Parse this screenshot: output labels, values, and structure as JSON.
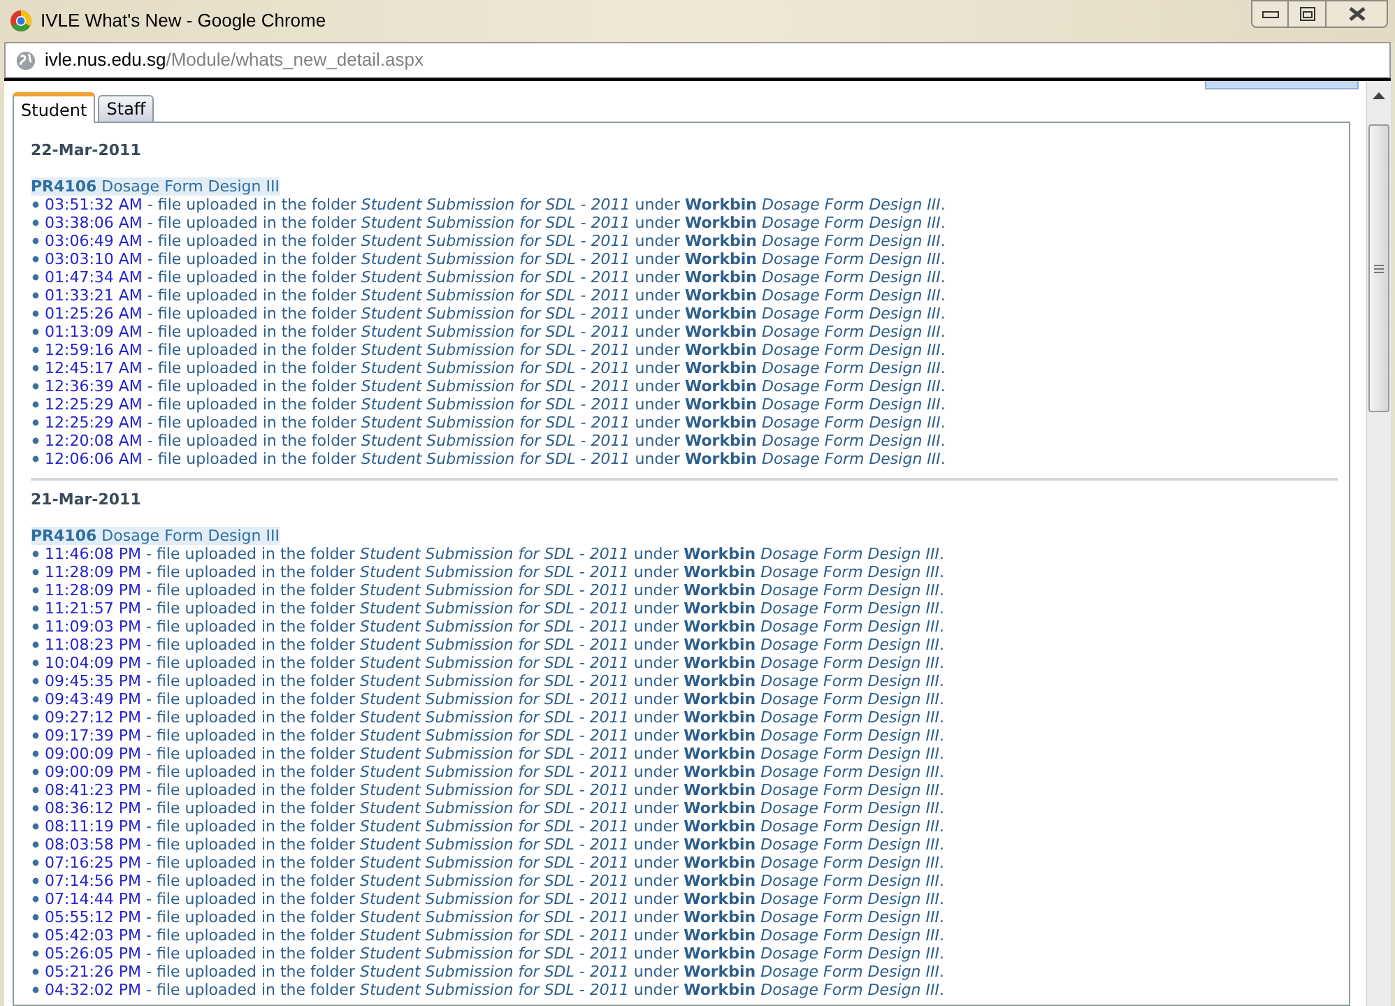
{
  "window": {
    "title": "IVLE What's New - Google Chrome"
  },
  "address_bar": {
    "host": "ivle.nus.edu.sg",
    "path": "/Module/whats_new_detail.aspx"
  },
  "tabs": [
    {
      "label": "Student",
      "selected": true
    },
    {
      "label": "Staff",
      "selected": false
    }
  ],
  "groups": [
    {
      "date": "22-Mar-2011",
      "module": {
        "code": "PR4106",
        "name": "Dosage Form Design III"
      },
      "entries": [
        {
          "time": "03:51:32 AM",
          "text": "- file uploaded in the folder *Student Submission for SDL - 2011* under **Workbin** *Dosage Form Design III*."
        },
        {
          "time": "03:38:06 AM",
          "text": "- file uploaded in the folder *Student Submission for SDL - 2011* under **Workbin** *Dosage Form Design III*."
        },
        {
          "time": "03:06:49 AM",
          "text": "- file uploaded in the folder *Student Submission for SDL - 2011* under **Workbin** *Dosage Form Design III*."
        },
        {
          "time": "03:03:10 AM",
          "text": "- file uploaded in the folder *Student Submission for SDL - 2011* under **Workbin** *Dosage Form Design III*."
        },
        {
          "time": "01:47:34 AM",
          "text": "- file uploaded in the folder *Student Submission for SDL - 2011* under **Workbin** *Dosage Form Design III*."
        },
        {
          "time": "01:33:21 AM",
          "text": "- file uploaded in the folder *Student Submission for SDL - 2011* under **Workbin** *Dosage Form Design III*."
        },
        {
          "time": "01:25:26 AM",
          "text": "- file uploaded in the folder *Student Submission for SDL - 2011* under **Workbin** *Dosage Form Design III*."
        },
        {
          "time": "01:13:09 AM",
          "text": "- file uploaded in the folder *Student Submission for SDL - 2011* under **Workbin** *Dosage Form Design III*."
        },
        {
          "time": "12:59:16 AM",
          "text": "- file uploaded in the folder *Student Submission for SDL - 2011* under **Workbin** *Dosage Form Design III*."
        },
        {
          "time": "12:45:17 AM",
          "text": "- file uploaded in the folder *Student Submission for SDL - 2011* under **Workbin** *Dosage Form Design III*."
        },
        {
          "time": "12:36:39 AM",
          "text": "- file uploaded in the folder *Student Submission for SDL - 2011* under **Workbin** *Dosage Form Design III*."
        },
        {
          "time": "12:25:29 AM",
          "text": "- file uploaded in the folder *Student Submission for SDL - 2011* under **Workbin** *Dosage Form Design III*."
        },
        {
          "time": "12:25:29 AM",
          "text": "- file uploaded in the folder *Student Submission for SDL - 2011* under **Workbin** *Dosage Form Design III*."
        },
        {
          "time": "12:20:08 AM",
          "text": "- file uploaded in the folder *Student Submission for SDL - 2011* under **Workbin** *Dosage Form Design III*."
        },
        {
          "time": "12:06:06 AM",
          "text": "- file uploaded in the folder *Student Submission for SDL - 2011* under **Workbin** *Dosage Form Design III*."
        }
      ]
    },
    {
      "date": "21-Mar-2011",
      "module": {
        "code": "PR4106",
        "name": "Dosage Form Design III"
      },
      "entries": [
        {
          "time": "11:46:08 PM",
          "text": "- file uploaded in the folder *Student Submission for SDL - 2011* under **Workbin** *Dosage Form Design III*."
        },
        {
          "time": "11:28:09 PM",
          "text": "- file uploaded in the folder *Student Submission for SDL - 2011* under **Workbin** *Dosage Form Design III*."
        },
        {
          "time": "11:28:09 PM",
          "text": "- file uploaded in the folder *Student Submission for SDL - 2011* under **Workbin** *Dosage Form Design III*."
        },
        {
          "time": "11:21:57 PM",
          "text": "- file uploaded in the folder *Student Submission for SDL - 2011* under **Workbin** *Dosage Form Design III*."
        },
        {
          "time": "11:09:03 PM",
          "text": "- file uploaded in the folder *Student Submission for SDL - 2011* under **Workbin** *Dosage Form Design III*."
        },
        {
          "time": "11:08:23 PM",
          "text": "- file uploaded in the folder *Student Submission for SDL - 2011* under **Workbin** *Dosage Form Design III*."
        },
        {
          "time": "10:04:09 PM",
          "text": "- file uploaded in the folder *Student Submission for SDL - 2011* under **Workbin** *Dosage Form Design III*."
        },
        {
          "time": "09:45:35 PM",
          "text": "- file uploaded in the folder *Student Submission for SDL - 2011* under **Workbin** *Dosage Form Design III*."
        },
        {
          "time": "09:43:49 PM",
          "text": "- file uploaded in the folder *Student Submission for SDL - 2011* under **Workbin** *Dosage Form Design III*."
        },
        {
          "time": "09:27:12 PM",
          "text": "- file uploaded in the folder *Student Submission for SDL - 2011* under **Workbin** *Dosage Form Design III*."
        },
        {
          "time": "09:17:39 PM",
          "text": "- file uploaded in the folder *Student Submission for SDL - 2011* under **Workbin** *Dosage Form Design III*."
        },
        {
          "time": "09:00:09 PM",
          "text": "- file uploaded in the folder *Student Submission for SDL - 2011* under **Workbin** *Dosage Form Design III*."
        },
        {
          "time": "09:00:09 PM",
          "text": "- file uploaded in the folder *Student Submission for SDL - 2011* under **Workbin** *Dosage Form Design III*."
        },
        {
          "time": "08:41:23 PM",
          "text": "- file uploaded in the folder *Student Submission for SDL - 2011* under **Workbin** *Dosage Form Design III*."
        },
        {
          "time": "08:36:12 PM",
          "text": "- file uploaded in the folder *Student Submission for SDL - 2011* under **Workbin** *Dosage Form Design III*."
        },
        {
          "time": "08:11:19 PM",
          "text": "- file uploaded in the folder *Student Submission for SDL - 2011* under **Workbin** *Dosage Form Design III*."
        },
        {
          "time": "08:03:58 PM",
          "text": "- file uploaded in the folder *Student Submission for SDL - 2011* under **Workbin** *Dosage Form Design III*."
        },
        {
          "time": "07:16:25 PM",
          "text": "- file uploaded in the folder *Student Submission for SDL - 2011* under **Workbin** *Dosage Form Design III*."
        },
        {
          "time": "07:14:56 PM",
          "text": "- file uploaded in the folder *Student Submission for SDL - 2011* under **Workbin** *Dosage Form Design III*."
        },
        {
          "time": "07:14:44 PM",
          "text": "- file uploaded in the folder *Student Submission for SDL - 2011* under **Workbin** *Dosage Form Design III*."
        },
        {
          "time": "05:55:12 PM",
          "text": "- file uploaded in the folder *Student Submission for SDL - 2011* under **Workbin** *Dosage Form Design III*."
        },
        {
          "time": "05:42:03 PM",
          "text": "- file uploaded in the folder *Student Submission for SDL - 2011* under **Workbin** *Dosage Form Design III*."
        },
        {
          "time": "05:26:05 PM",
          "text": "- file uploaded in the folder *Student Submission for SDL - 2011* under **Workbin** *Dosage Form Design III*."
        },
        {
          "time": "05:21:26 PM",
          "text": "- file uploaded in the folder *Student Submission for SDL - 2011* under **Workbin** *Dosage Form Design III*."
        },
        {
          "time": "04:32:02 PM",
          "text": "- file uploaded in the folder *Student Submission for SDL - 2011* under **Workbin** *Dosage Form Design III*."
        }
      ]
    }
  ]
}
